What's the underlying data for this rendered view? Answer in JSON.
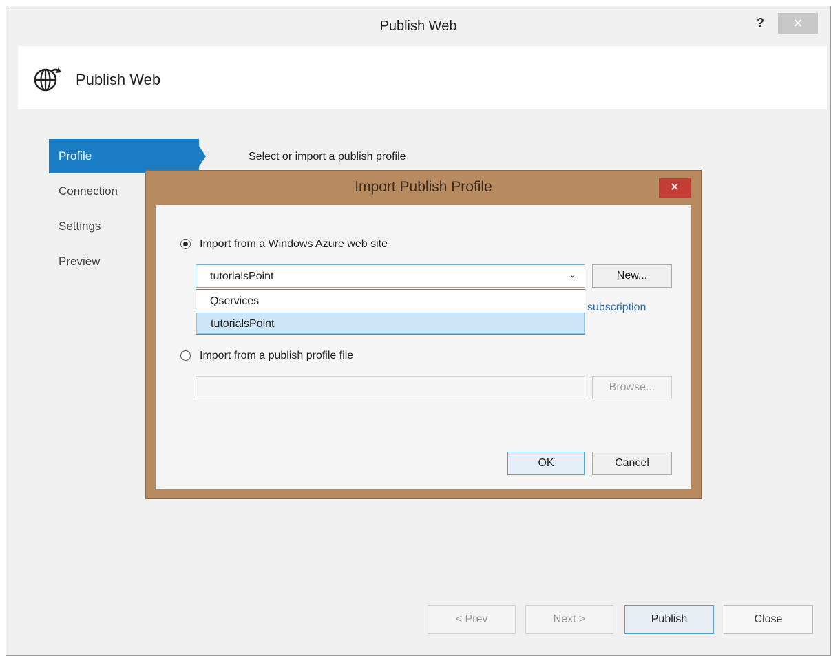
{
  "window": {
    "title": "Publish Web",
    "help_label": "?",
    "close_label": "✕"
  },
  "header": {
    "title": "Publish Web",
    "icon": "globe-publish-icon"
  },
  "nav": {
    "items": [
      {
        "label": "Profile",
        "active": true
      },
      {
        "label": "Connection",
        "active": false
      },
      {
        "label": "Settings",
        "active": false
      },
      {
        "label": "Preview",
        "active": false
      }
    ]
  },
  "main": {
    "instruction": "Select or import a publish profile"
  },
  "modal": {
    "title": "Import Publish Profile",
    "close_label": "✕",
    "option_azure": {
      "label": "Import from a Windows Azure web site",
      "checked": true
    },
    "site_select": {
      "value": "tutorialsPoint",
      "options": [
        "Qservices",
        "tutorialsPoint"
      ],
      "highlighted": "tutorialsPoint"
    },
    "new_button": "New...",
    "subscription_link": "subscription",
    "option_file": {
      "label": "Import from a publish profile file",
      "checked": false
    },
    "file_path": {
      "value": "",
      "placeholder": ""
    },
    "browse_button": "Browse...",
    "ok_button": "OK",
    "cancel_button": "Cancel"
  },
  "footer": {
    "prev_button": "< Prev",
    "next_button": "Next >",
    "publish_button": "Publish",
    "close_button": "Close"
  },
  "colors": {
    "accent": "#1a7dc4",
    "modal_frame": "#b88a5f",
    "modal_close": "#c43c36",
    "link": "#2a6fb0"
  }
}
